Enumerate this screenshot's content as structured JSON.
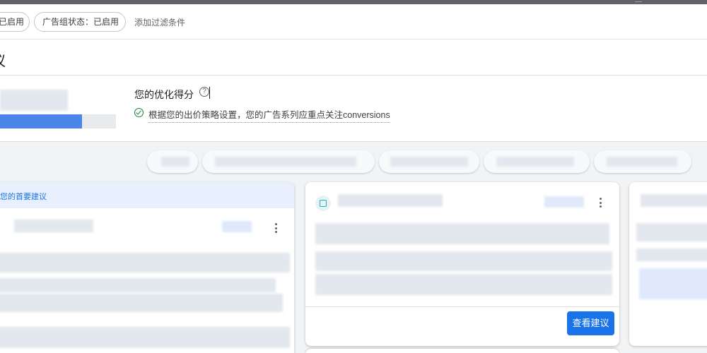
{
  "filters": {
    "status_chip": "已启用",
    "adgroup_status_chip": "广告组状态：已启用",
    "add_filter": "添加过滤条件"
  },
  "page": {
    "title": "议"
  },
  "optimization": {
    "label": "您的优化得分",
    "help_icon": "help-circle-icon",
    "help_glyph": "?",
    "message": "根据您的出价策略设置，您的广告系列应重点关注conversions",
    "status_icon": "check-circle-icon"
  },
  "cards": {
    "priority_label": "您的首要建议",
    "view_button": "查看建议"
  },
  "colors": {
    "accent": "#1a73e8",
    "score_bar": "#4a86e8",
    "success": "#188038"
  }
}
